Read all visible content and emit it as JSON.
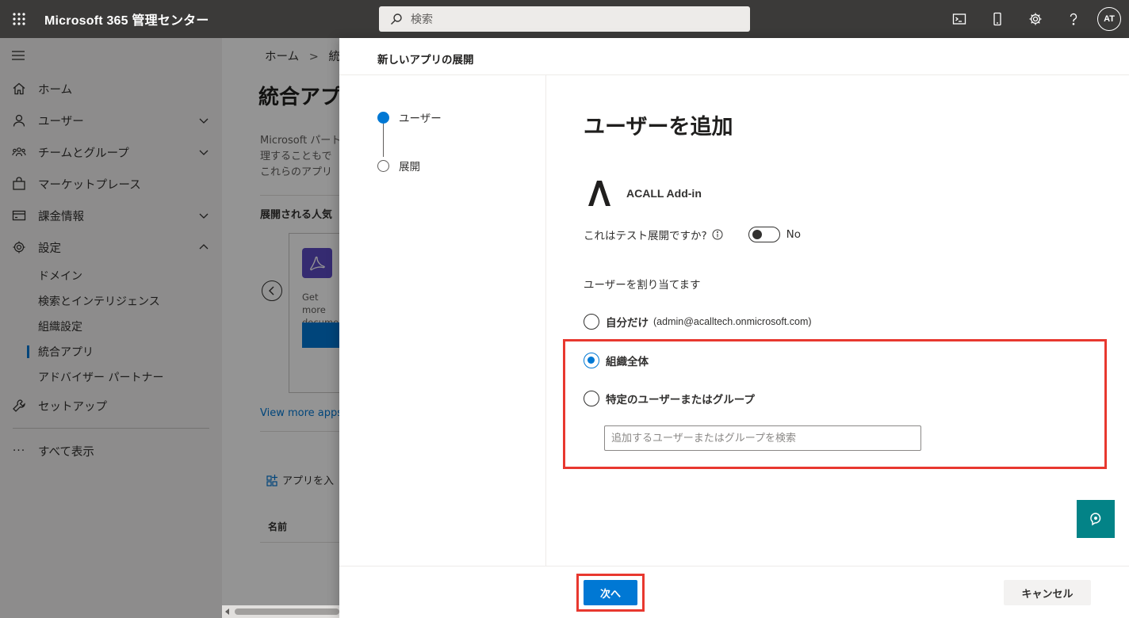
{
  "topbar": {
    "app_title": "Microsoft 365 管理センター",
    "search_placeholder": "検索",
    "avatar_initials": "AT"
  },
  "nav": {
    "items": [
      {
        "label": "ホーム",
        "icon": "home-icon"
      },
      {
        "label": "ユーザー",
        "icon": "user-icon"
      },
      {
        "label": "チームとグループ",
        "icon": "groups-icon"
      },
      {
        "label": "マーケットプレース",
        "icon": "bag-icon"
      },
      {
        "label": "課金情報",
        "icon": "card-icon"
      },
      {
        "label": "設定",
        "icon": "gear-icon"
      }
    ],
    "sub_items": [
      "ドメイン",
      "検索とインテリジェンス",
      "組織設定",
      "統合アプリ",
      "アドバイザー パートナー"
    ],
    "setup": "セットアップ",
    "show_all": "すべて表示"
  },
  "main": {
    "breadcrumb_home": "ホーム",
    "breadcrumb_current": "統合",
    "title": "統合アプ",
    "desc_lines": [
      "Microsoft パート",
      "理することもで",
      "これらのアプリ"
    ],
    "popular": "展開される人気",
    "card_text_1": "Get more",
    "card_text_2": "documen",
    "view_more": "View more apps",
    "add_app": "アプリを入",
    "col_name": "名前"
  },
  "panel": {
    "title": "新しいアプリの展開",
    "steps": [
      "ユーザー",
      "展開"
    ],
    "heading": "ユーザーを追加",
    "app_name": "ACALL Add-in",
    "test_question": "これはテスト展開ですか?",
    "toggle_label": "No",
    "assign_label": "ユーザーを割り当てます",
    "option_me": "自分だけ",
    "option_me_sub": "(admin@acalltech.onmicrosoft.com)",
    "option_org": "組織全体",
    "option_specific": "特定のユーザーまたはグループ",
    "search_placeholder": "追加するユーザーまたはグループを検索",
    "next": "次へ",
    "cancel": "キャンセル"
  },
  "colors": {
    "accent": "#0078d4",
    "highlight": "#e8382f",
    "topbar": "#3b3a39",
    "feedback": "#038387"
  }
}
